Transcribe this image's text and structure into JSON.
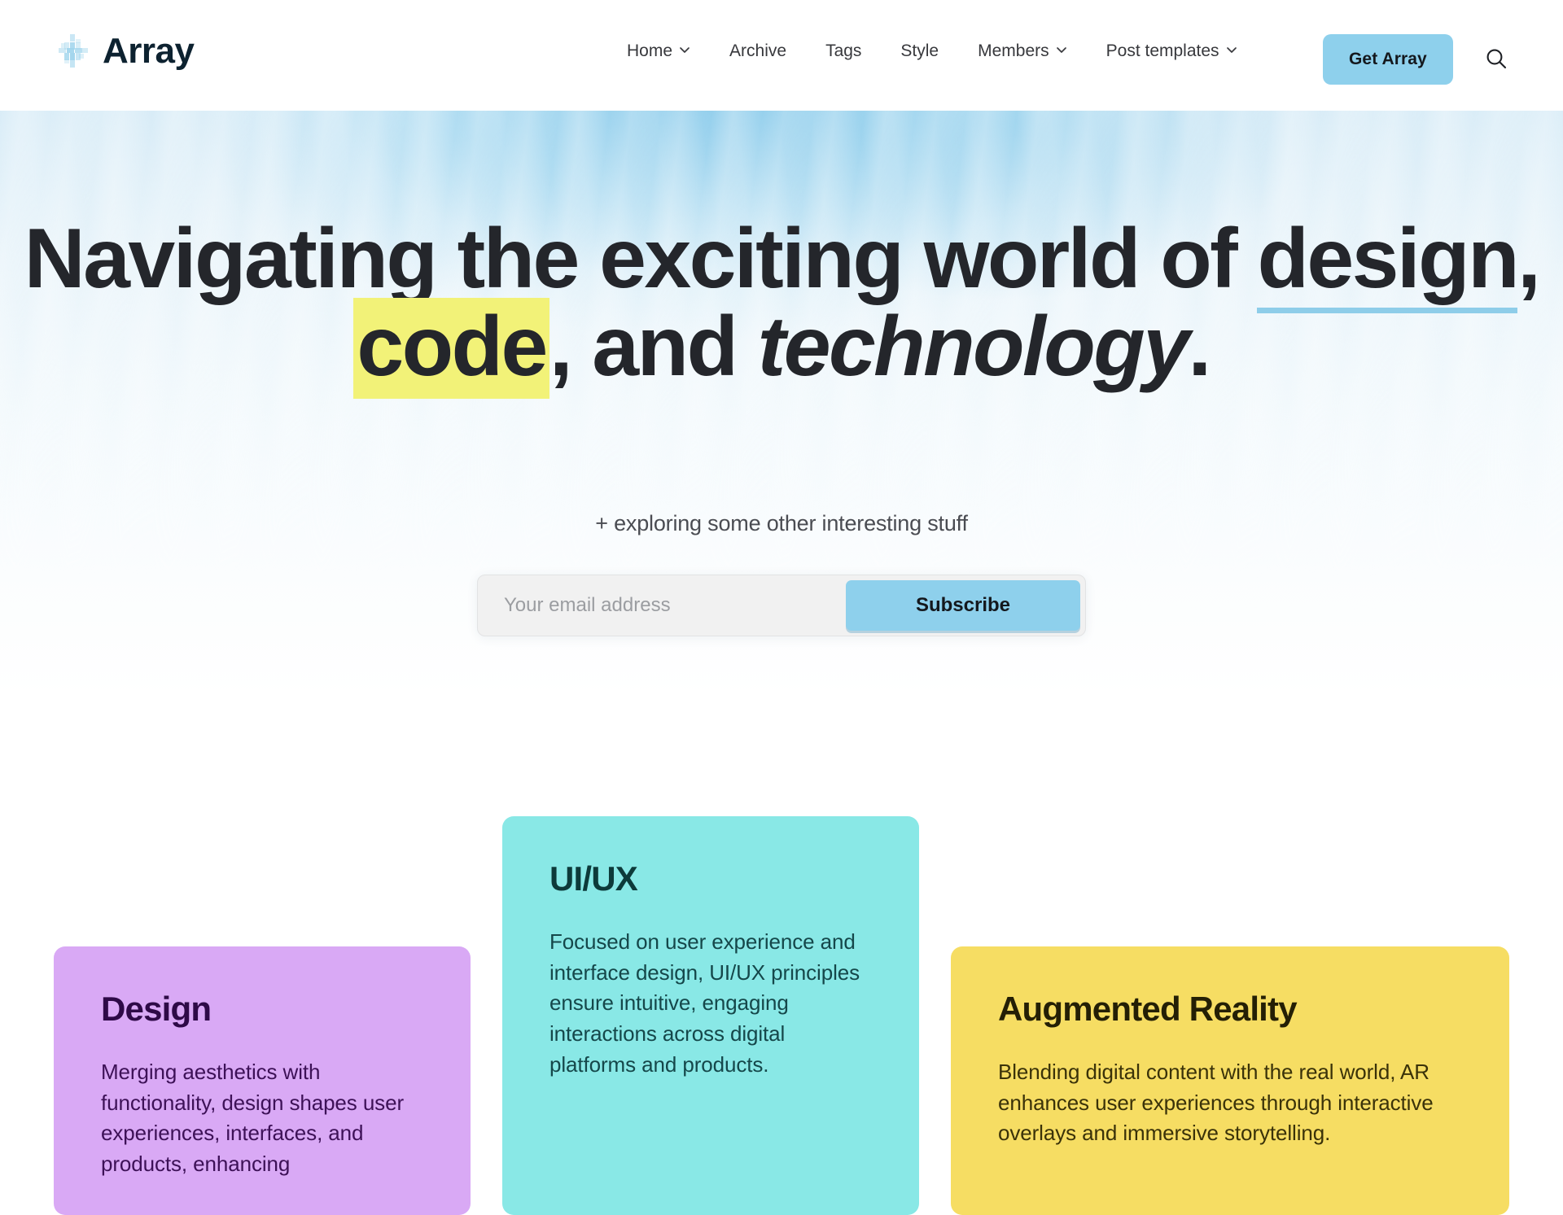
{
  "header": {
    "brand": {
      "name": "Array",
      "logo_icon": "pinwheel-logo-icon",
      "logo_color": "#8ecde9"
    },
    "nav": [
      {
        "label": "Home",
        "has_dropdown": true
      },
      {
        "label": "Archive",
        "has_dropdown": false
      },
      {
        "label": "Tags",
        "has_dropdown": false
      },
      {
        "label": "Style",
        "has_dropdown": false
      },
      {
        "label": "Members",
        "has_dropdown": true
      },
      {
        "label": "Post templates",
        "has_dropdown": true
      }
    ],
    "cta_label": "Get Array",
    "cta_color": "#8ed0ec",
    "search_icon": "search-icon"
  },
  "hero": {
    "title_part1": "Navigating the exciting world of ",
    "title_design": "design",
    "title_comma1": ", ",
    "title_code": "code",
    "title_comma2": ",",
    "title_and": " and ",
    "title_technology": "technology",
    "title_period": ".",
    "underline_color": "#8ecde9",
    "highlight_color": "#f2f278",
    "subtitle": "+ exploring some other interesting stuff",
    "email_placeholder": "Your email address",
    "email_value": "",
    "subscribe_label": "Subscribe",
    "subscribe_color": "#8ed0ec"
  },
  "cards": [
    {
      "title": "Design",
      "body": "Merging aesthetics with functionality, design shapes user experiences, interfaces, and products, enhancing",
      "bg": "#d9a9f5"
    },
    {
      "title": "UI/UX",
      "body": "Focused on user experience and interface design, UI/UX principles ensure intuitive, engaging interactions across digital platforms and products.",
      "bg": "#89e8e6"
    },
    {
      "title": "Augmented Reality",
      "body": "Blending digital content with the real world, AR enhances user experiences through interactive overlays and immersive storytelling.",
      "bg": "#f6dd63"
    }
  ]
}
